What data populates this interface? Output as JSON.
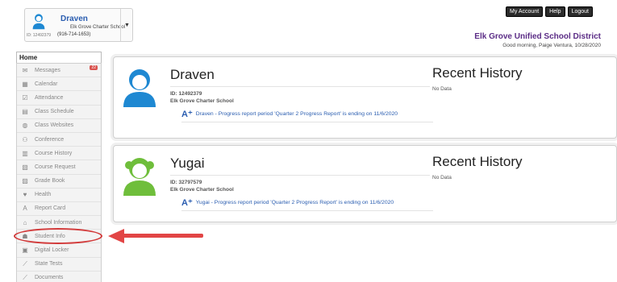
{
  "header": {
    "student_name": "Draven",
    "school": "Elk Grove Charter School",
    "id_label": "ID: 12492379",
    "phone": "(916-714-1653)",
    "buttons": [
      "My Account",
      "Help",
      "Logout"
    ],
    "district": "Elk Grove Unified School District",
    "greeting": "Good morning, Paige Ventura, 10/28/2020"
  },
  "sidebar": {
    "home_tab": "Home",
    "messages_badge": "22",
    "items": [
      {
        "label": "Messages",
        "icon": "envelope-icon"
      },
      {
        "label": "Calendar",
        "icon": "calendar-icon"
      },
      {
        "label": "Attendance",
        "icon": "checkmark-icon"
      },
      {
        "label": "Class Schedule",
        "icon": "schedule-icon"
      },
      {
        "label": "Class Websites",
        "icon": "globe-icon"
      },
      {
        "label": "Conference",
        "icon": "people-icon"
      },
      {
        "label": "Course History",
        "icon": "books-icon"
      },
      {
        "label": "Course Request",
        "icon": "request-icon"
      },
      {
        "label": "Grade Book",
        "icon": "gradebook-icon"
      },
      {
        "label": "Health",
        "icon": "heart-icon"
      },
      {
        "label": "Report Card",
        "icon": "report-card-icon"
      },
      {
        "label": "School Information",
        "icon": "school-icon"
      },
      {
        "label": "Student Info",
        "icon": "student-icon"
      },
      {
        "label": "Digital Locker",
        "icon": "locker-icon"
      },
      {
        "label": "State Tests",
        "icon": "chart-icon"
      },
      {
        "label": "Documents",
        "icon": "document-icon"
      }
    ]
  },
  "cards": [
    {
      "name": "Draven",
      "id": "ID: 12492379",
      "school": "Elk Grove Charter School",
      "message": "Draven - Progress report period 'Quarter 2 Progress Report' is ending on 11/6/2020",
      "recent_title": "Recent History",
      "recent_body": "No Data",
      "avatar_color": "#1e88d2"
    },
    {
      "name": "Yugai",
      "id": "ID: 32797579",
      "school": "Elk Grove Charter School",
      "message": "Yugai - Progress report period 'Quarter 2 Progress Report' is ending on 11/6/2020",
      "recent_title": "Recent History",
      "recent_body": "No Data",
      "avatar_color": "#6fbe3b"
    }
  ],
  "colors": {
    "link": "#2a5db0",
    "district": "#5b2c86",
    "annotation": "#e24545"
  }
}
